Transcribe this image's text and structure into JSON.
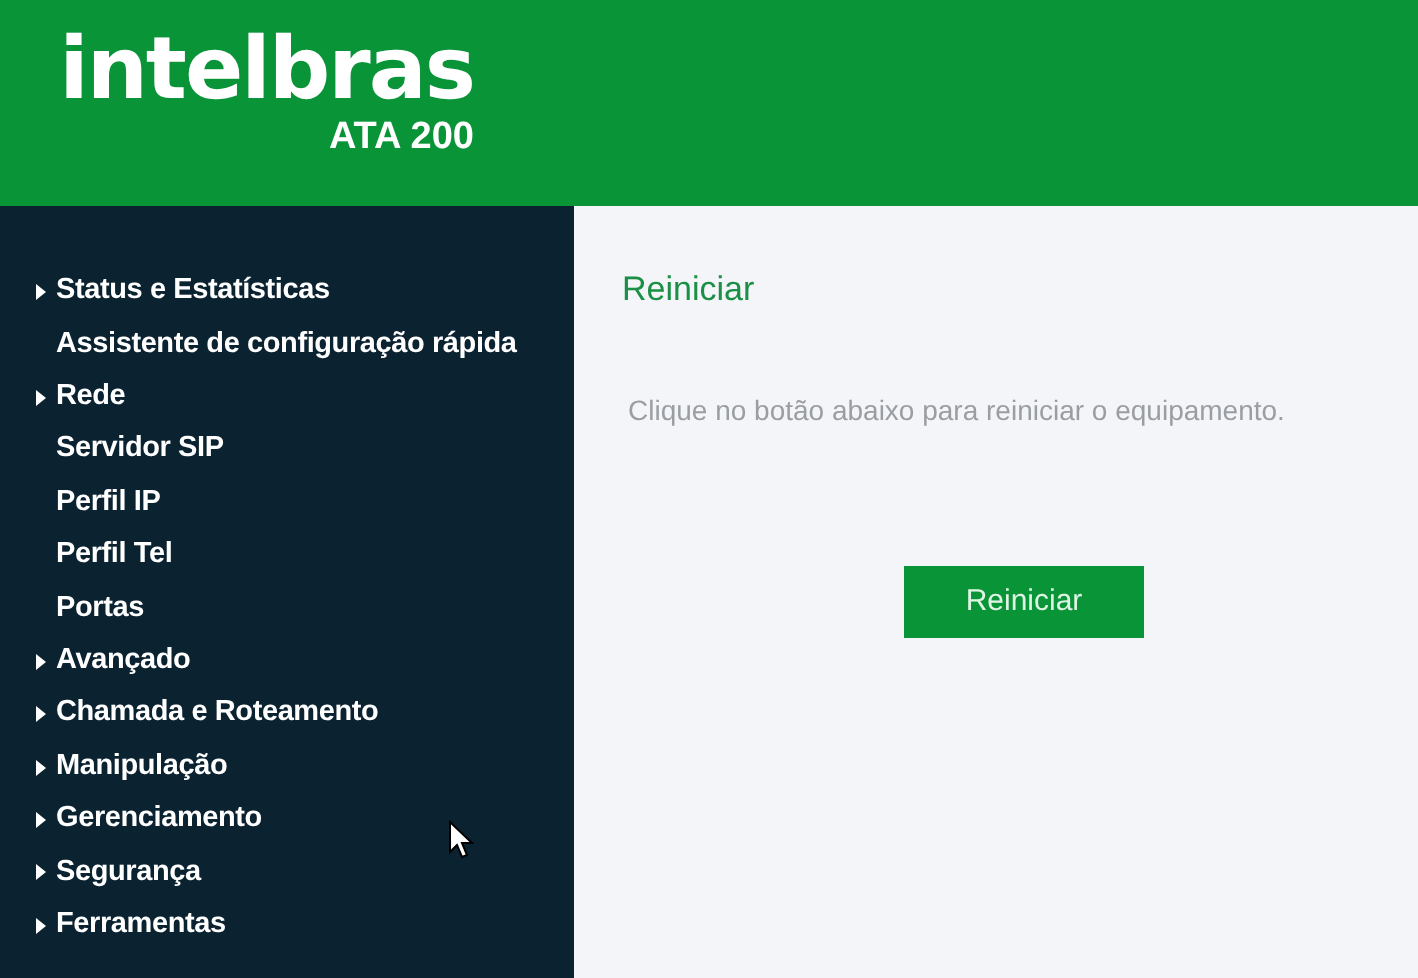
{
  "header": {
    "logo": "intelbras",
    "model": "ATA 200"
  },
  "sidebar": {
    "items": [
      {
        "label": "Status e Estatísticas",
        "expandable": true
      },
      {
        "label": "Assistente de configuração rápida",
        "expandable": false
      },
      {
        "label": "Rede",
        "expandable": true
      },
      {
        "label": "Servidor SIP",
        "expandable": false
      },
      {
        "label": "Perfil IP",
        "expandable": false
      },
      {
        "label": "Perfil Tel",
        "expandable": false
      },
      {
        "label": "Portas",
        "expandable": false
      },
      {
        "label": "Avançado",
        "expandable": true
      },
      {
        "label": "Chamada e Roteamento",
        "expandable": true
      },
      {
        "label": "Manipulação",
        "expandable": true
      },
      {
        "label": "Gerenciamento",
        "expandable": true
      },
      {
        "label": "Segurança",
        "expandable": true
      },
      {
        "label": "Ferramentas",
        "expandable": true
      }
    ]
  },
  "content": {
    "title": "Reiniciar",
    "message": "Clique no botão abaixo para reiniciar o equipamento.",
    "button": "Reiniciar"
  }
}
